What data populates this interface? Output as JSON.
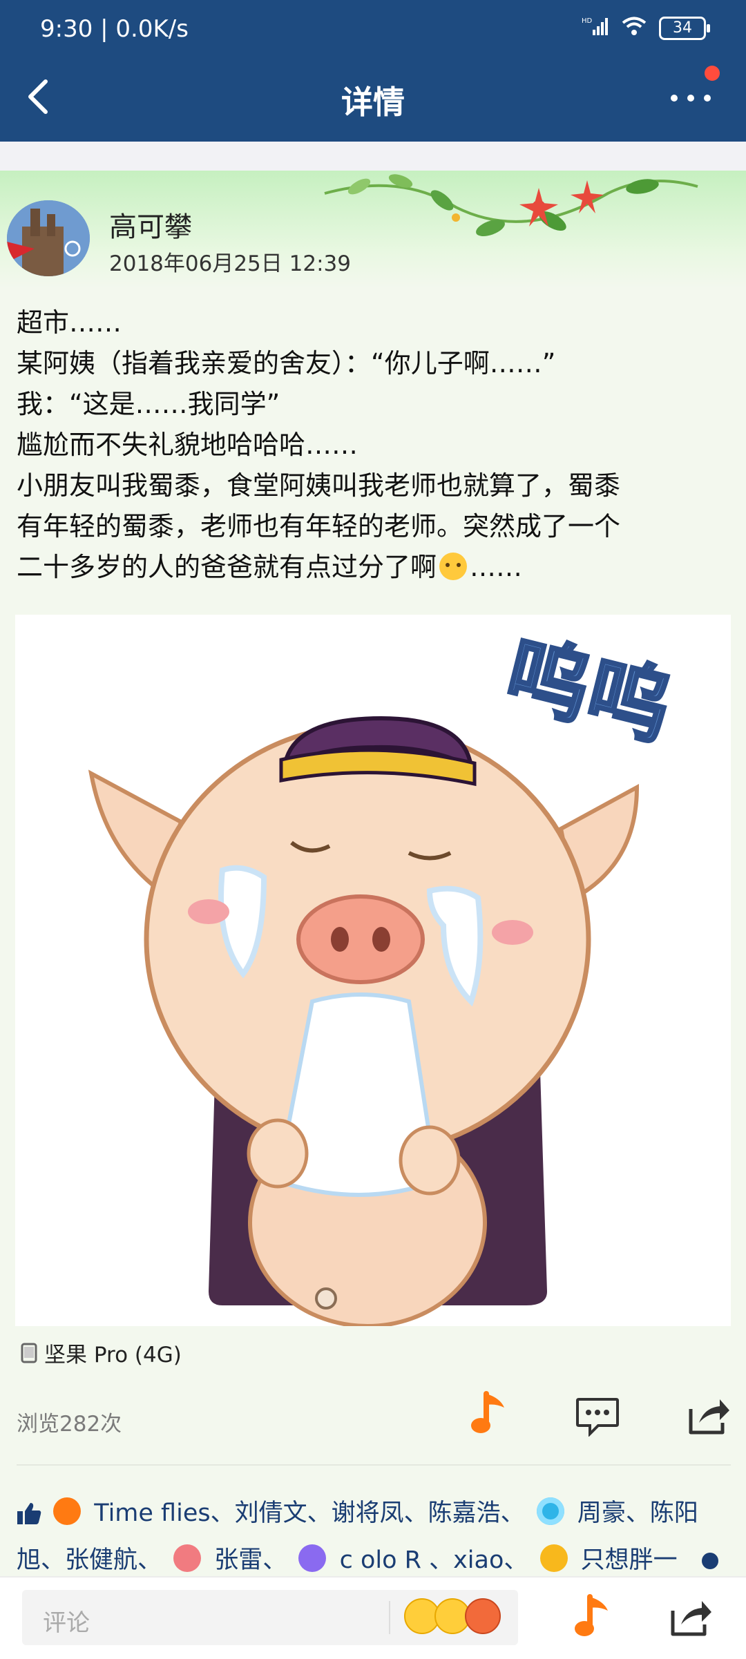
{
  "status": {
    "time": "9:30 | 0.0K/s",
    "network": "HD",
    "battery": "34"
  },
  "header": {
    "title": "详情"
  },
  "post": {
    "author": "高可攀",
    "date": "2018年06月25日 12:39",
    "lines": [
      "超市……",
      "某阿姨（指着我亲爱的舍友）：“你儿子啊……”",
      "我：“这是……我同学”",
      "尴尬而不失礼貌地哈哈哈……",
      "小朋友叫我蜀黍，食堂阿姨叫我老师也就算了，蜀黍",
      "有年轻的蜀黍，老师也有年轻的老师。突然成了一个",
      "二十多岁的人的爸爸就有点过分了啊",
      "……"
    ],
    "sticker_text": "呜呜",
    "device": "坚果 Pro (4G)",
    "views": "浏览282次"
  },
  "likes": {
    "line1": [
      "Time flies、刘倩文、谢将凤、陈嘉浩、",
      "周豪、陈阳"
    ],
    "line2": [
      "旭、张健航、",
      "张雷、",
      "c olo R 、xiao、",
      "只想胖一"
    ]
  },
  "comment": {
    "placeholder": "评论"
  },
  "colors": {
    "appbar": "#1e4b80",
    "accent": "#ff7a12",
    "link": "#1a3d73"
  },
  "icons": [
    "back-icon",
    "more-icon",
    "music-note-icon",
    "comment-icon",
    "share-icon",
    "thumbs-up-icon",
    "device-icon"
  ]
}
